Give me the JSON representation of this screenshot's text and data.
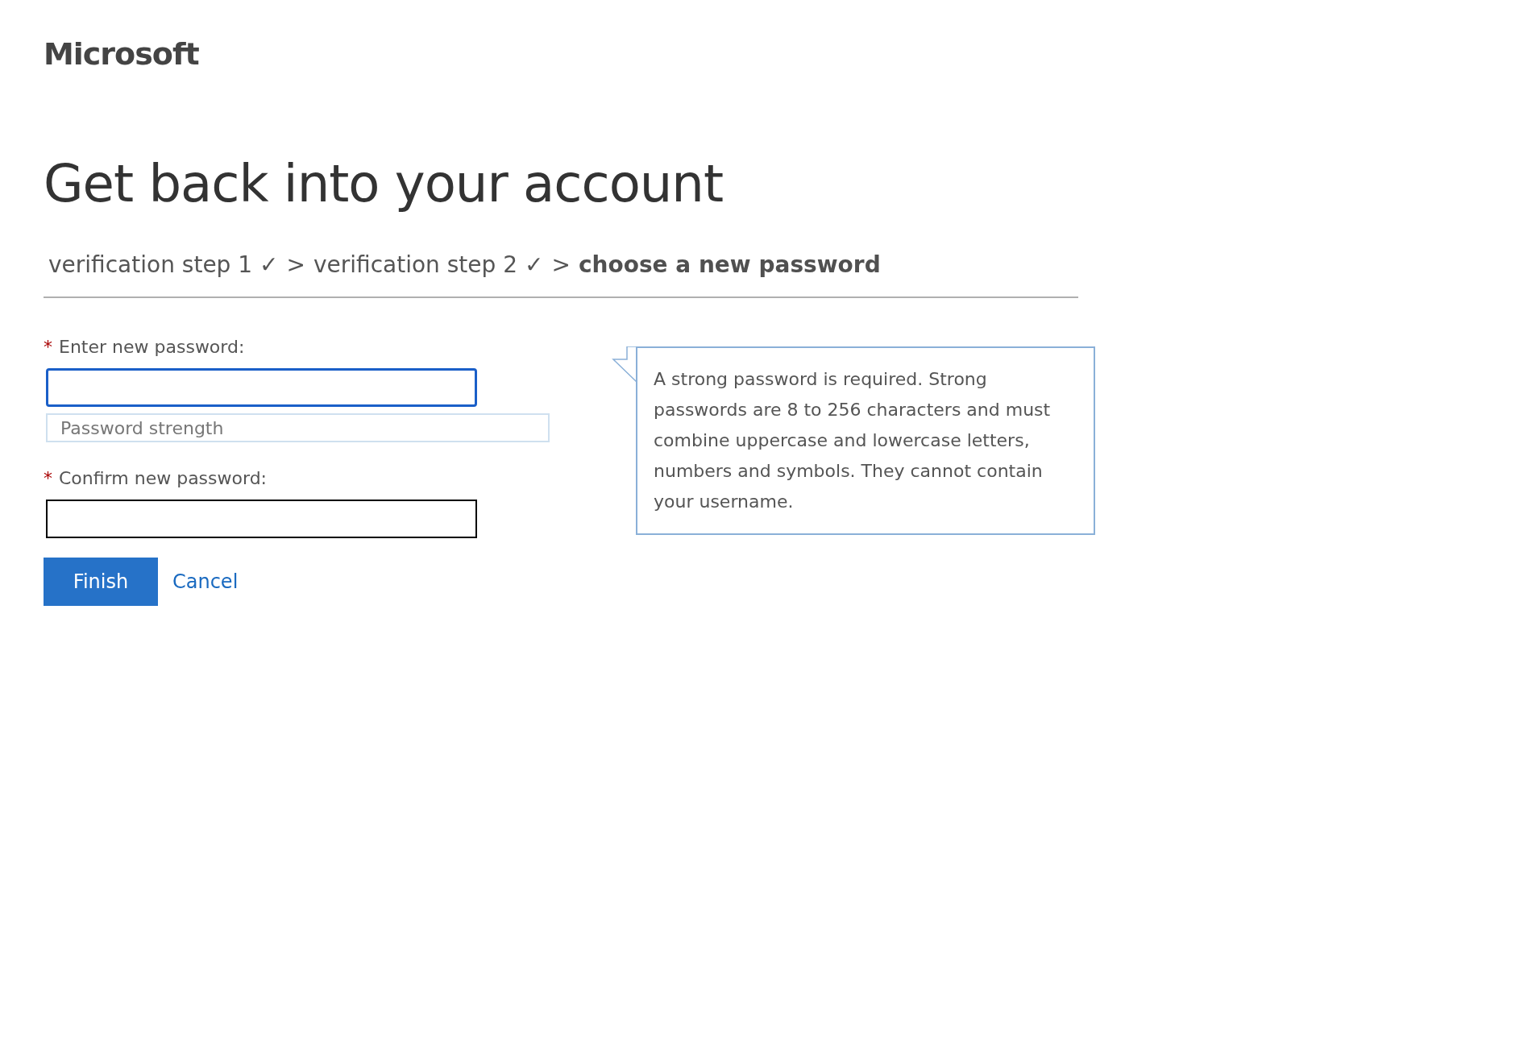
{
  "logo": "Microsoft",
  "title": "Get back into your account",
  "breadcrumb": [
    {
      "kind": "step",
      "label": "verification step 1 ✓",
      "current": false
    },
    {
      "kind": "separator",
      "label": ">"
    },
    {
      "kind": "step",
      "label": "verification step 2 ✓",
      "current": false
    },
    {
      "kind": "separator",
      "label": ">"
    },
    {
      "kind": "step",
      "label": "choose a new password",
      "current": true
    }
  ],
  "fields": [
    {
      "required_mark": "*",
      "label": "Enter new password:",
      "focused": true,
      "strength_placeholder": "Password strength"
    },
    {
      "required_mark": "*",
      "label": "Confirm new password:",
      "focused": false
    }
  ],
  "tooltip": "A strong password is required. Strong passwords are 8 to 256 characters and must combine uppercase and lowercase letters, numbers and symbols. They cannot contain your username.",
  "buttons": {
    "primary": "Finish",
    "link": "Cancel"
  }
}
